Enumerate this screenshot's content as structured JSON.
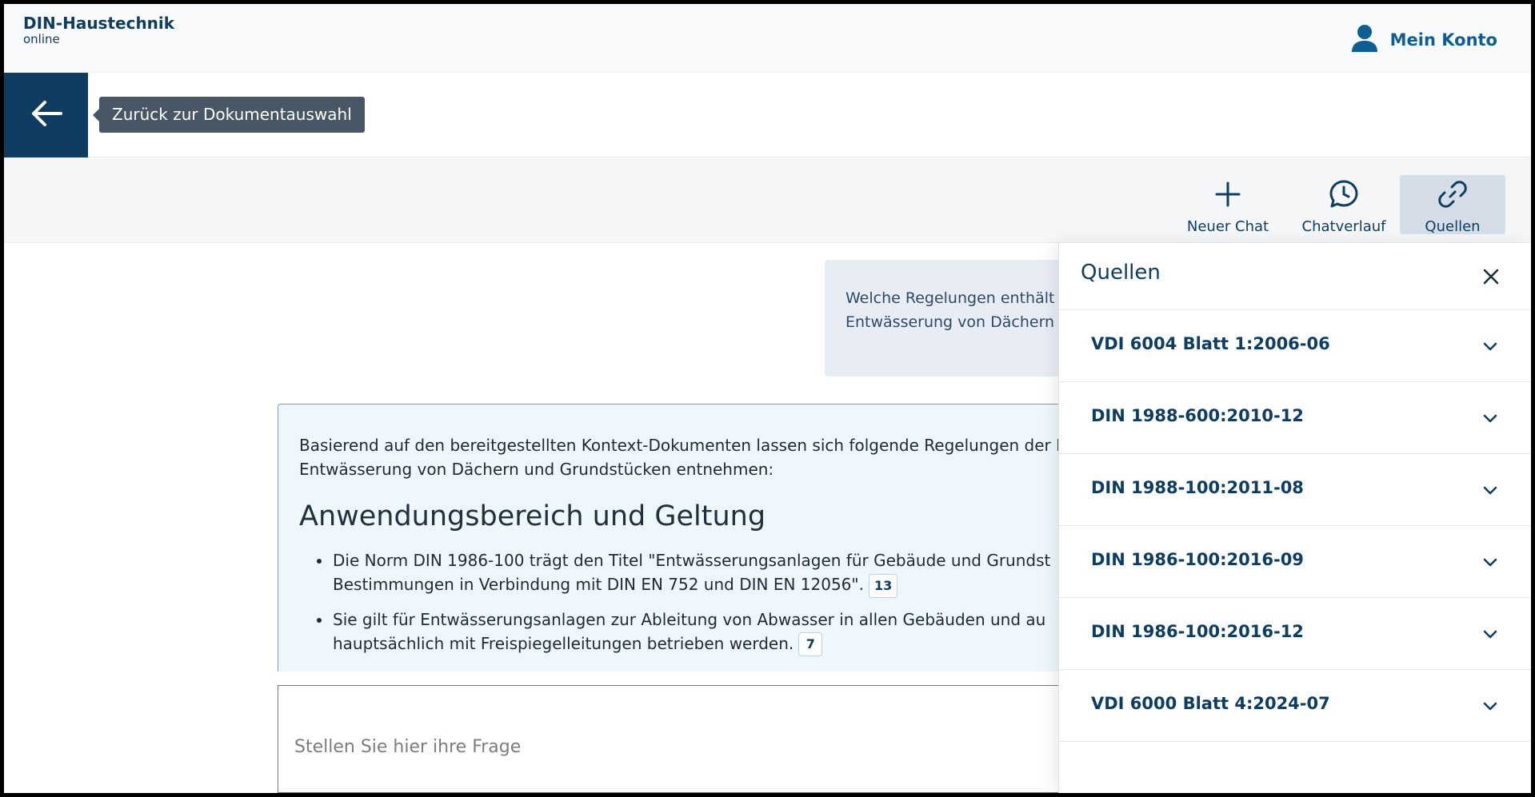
{
  "header": {
    "brand_main": "DIN-Haustechnik",
    "brand_sub": "online",
    "account_label": "Mein Konto",
    "account_icon": "user-icon"
  },
  "back": {
    "tooltip": "Zurück zur Dokumentauswahl",
    "icon": "arrow-left-icon"
  },
  "toolbar": {
    "new_chat": "Neuer Chat",
    "history": "Chatverlauf",
    "sources": "Quellen"
  },
  "chat": {
    "user_message_line1": "Welche Regelungen enthält",
    "user_message_line2": "Entwässerung von Dächern",
    "answer_intro_line1": "Basierend auf den bereitgestellten Kontext-Dokumenten lassen sich folgende Regelungen der D",
    "answer_intro_line2": "Entwässerung von Dächern und Grundstücken entnehmen:",
    "answer_heading": "Anwendungsbereich und Geltung",
    "bullets": [
      {
        "line1": "Die Norm DIN 1986-100 trägt den Titel \"Entwässerungsanlagen für Gebäude und Grundst",
        "line2": "Bestimmungen in Verbindung mit DIN EN 752 und DIN EN 12056\".",
        "cite": "13"
      },
      {
        "line1": "Sie gilt für Entwässerungsanlagen zur Ableitung von Abwasser in allen Gebäuden und au",
        "line2": "hauptsächlich mit Freispiegelleitungen betrieben werden.",
        "cite": "7"
      }
    ],
    "input_placeholder": "Stellen Sie hier ihre Frage"
  },
  "sources_panel": {
    "title": "Quellen",
    "items": [
      {
        "label": "VDI 6004 Blatt 1:2006-06"
      },
      {
        "label": "DIN 1988-600:2010-12"
      },
      {
        "label": "DIN 1988-100:2011-08"
      },
      {
        "label": "DIN 1986-100:2016-09"
      },
      {
        "label": "DIN 1986-100:2016-12"
      },
      {
        "label": "VDI 6000 Blatt 4:2024-07"
      }
    ]
  },
  "colors": {
    "primary": "#0d3d63",
    "back_button": "#0e3d61",
    "tooltip_bg": "#475766",
    "answer_bg": "#eef8fc",
    "user_bubble_bg": "#e8edf5",
    "active_tool_bg": "#d5dde6"
  }
}
